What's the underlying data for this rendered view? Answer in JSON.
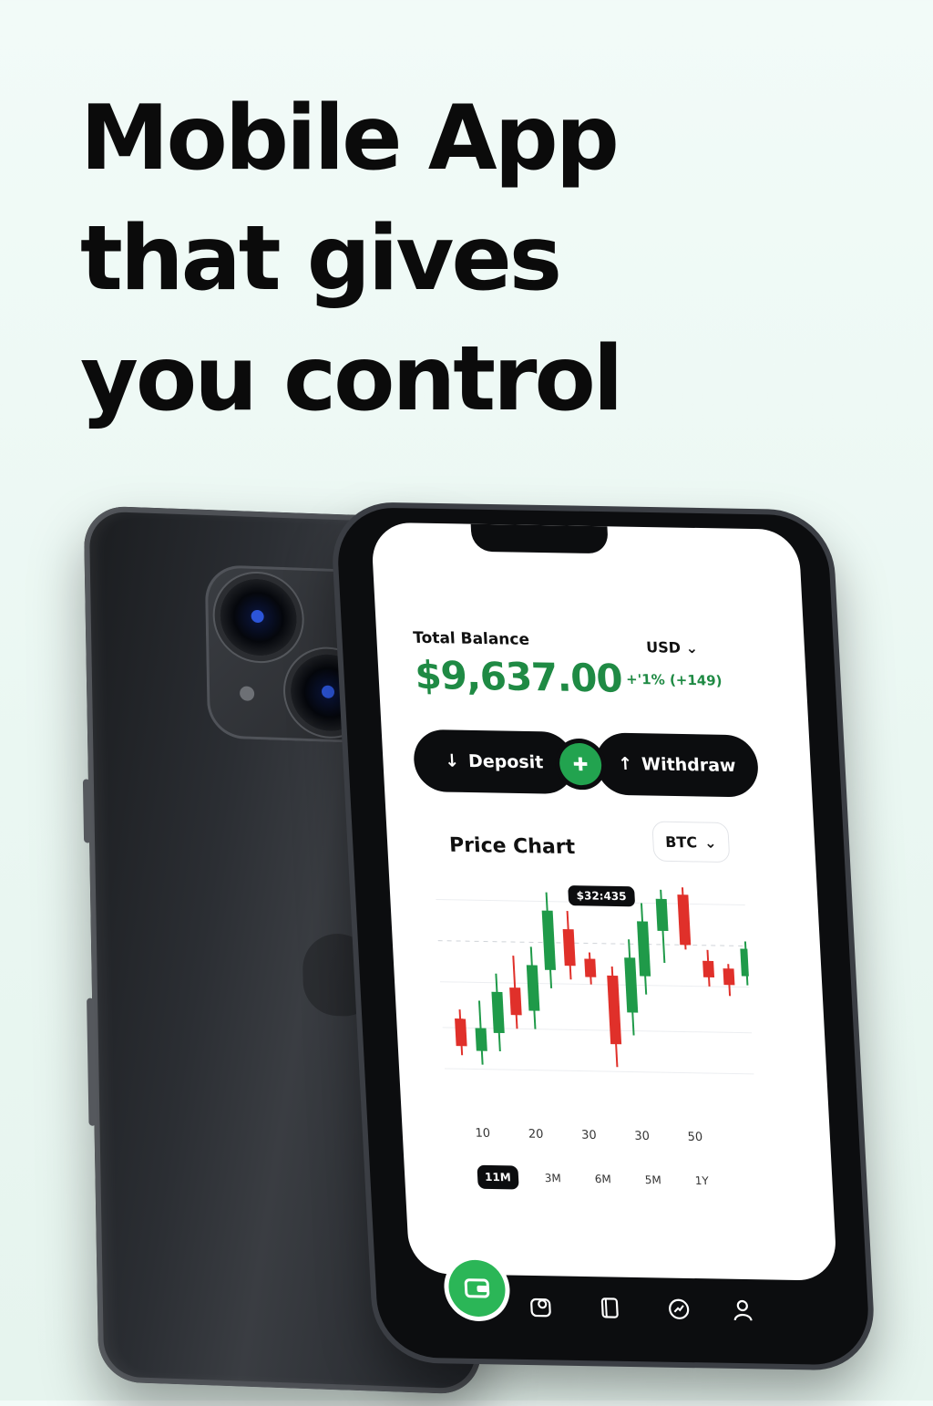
{
  "headline": {
    "line1": "Mobile App",
    "line2": "that gives",
    "line3": "you control"
  },
  "balance": {
    "label": "Total Balance",
    "amount": "$9,637.00",
    "currency": "USD",
    "change": "+'1% (+149)"
  },
  "actions": {
    "deposit": "Deposit",
    "withdraw": "Withdraw"
  },
  "price_chart": {
    "title": "Price Chart",
    "coin": "BTC",
    "tooltip": "$32:435",
    "x_ticks": [
      "10",
      "20",
      "30",
      "30",
      "50"
    ],
    "ranges": [
      "11M",
      "3M",
      "6M",
      "5M",
      "1Y"
    ],
    "active_range": "11M"
  },
  "colors": {
    "accent_green": "#1f8a44",
    "up_candle": "#1f9a49",
    "down_candle": "#e0302a",
    "dark": "#0c0d0f"
  },
  "icons": {
    "home": "wallet-icon",
    "tab2": "portfolio-icon",
    "tab3": "cards-icon",
    "tab4": "markets-icon",
    "tab5": "profile-icon"
  }
}
